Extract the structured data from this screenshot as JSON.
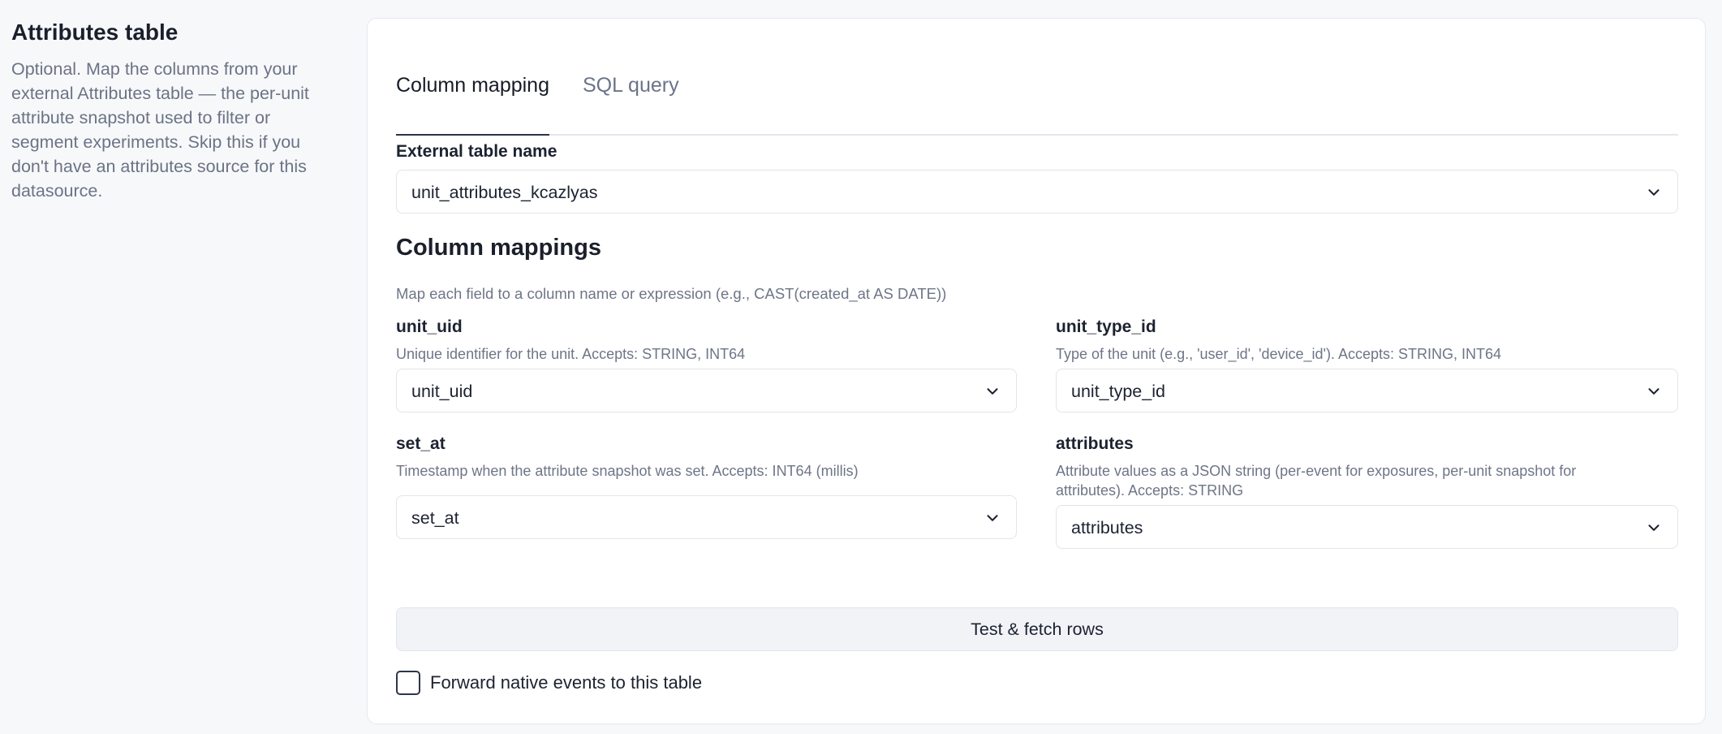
{
  "intro": {
    "title": "Attributes table",
    "description": "Optional. Map the columns from your external Attributes table — the per-unit attribute snapshot used to filter or segment experiments. Skip this if you don't have an attributes source for this datasource."
  },
  "tabs": [
    {
      "label": "Column mapping",
      "active": true
    },
    {
      "label": "SQL query",
      "active": false
    }
  ],
  "external_table": {
    "label": "External table name",
    "value": "unit_attributes_kcazlyas"
  },
  "mappings": {
    "title": "Column mappings",
    "subtitle": "Map each field to a column name or expression (e.g., CAST(created_at AS DATE))",
    "fields": [
      {
        "name": "unit_uid",
        "help": "Unique identifier for the unit. Accepts: STRING, INT64",
        "value": "unit_uid"
      },
      {
        "name": "unit_type_id",
        "help": "Type of the unit (e.g., 'user_id', 'device_id'). Accepts: STRING, INT64",
        "value": "unit_type_id"
      },
      {
        "name": "set_at",
        "help": "Timestamp when the attribute snapshot was set. Accepts: INT64 (millis)",
        "value": "set_at"
      },
      {
        "name": "attributes",
        "help": "Attribute values as a JSON string (per-event for exposures, per-unit snapshot for attributes). Accepts: STRING",
        "value": "attributes"
      }
    ]
  },
  "test_button": "Test & fetch rows",
  "forward_checkbox": {
    "label": "Forward native events to this table",
    "checked": false
  },
  "colors": {
    "accent": "#2b3347",
    "muted": "#6b7385",
    "background": "#f7f8fa"
  }
}
